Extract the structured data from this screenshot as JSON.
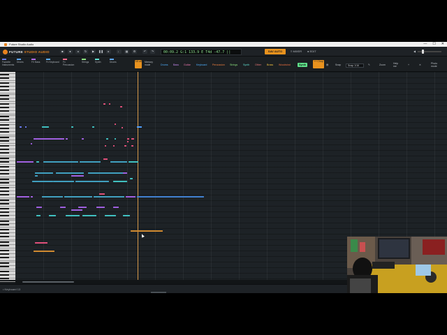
{
  "window": {
    "title": "Future Studio Audio",
    "controls": [
      "—",
      "☐",
      "✕"
    ]
  },
  "app": {
    "brand": "FUTURE",
    "brand_accent": "STUDIO AUDIO"
  },
  "transport": {
    "display": "00:09.2  G:1  133.9  E T4d  -47.7   ||"
  },
  "top_right": {
    "save_label": "SAV AUTO",
    "mixer_label": "≡ MIXER",
    "edit_label": "● EDIT"
  },
  "categories": [
    {
      "label": "Favorite Instruments",
      "color": "#6b7cf0"
    },
    {
      "label": "Drums",
      "color": "#5fa8ff"
    },
    {
      "label": "FX Bass",
      "color": "#b36cf0"
    },
    {
      "label": "Fx Keyboard",
      "color": "#5fb0ff"
    },
    {
      "label": "Fx Percussion",
      "color": "#ff6b8a"
    },
    {
      "label": "Strings",
      "color": "#8adf7e"
    },
    {
      "label": "Synth",
      "color": "#60e0d0"
    },
    {
      "label": "Drums",
      "color": "#5fa8ff"
    }
  ],
  "filter_pills": [
    {
      "label": "Drums",
      "color": "#4fb0ff"
    },
    {
      "label": "Bass",
      "color": "#c98af0"
    },
    {
      "label": "Guitar",
      "color": "#f07ab0"
    },
    {
      "label": "Keyboard",
      "color": "#4fb0ff"
    },
    {
      "label": "Percussion",
      "color": "#f08040"
    },
    {
      "label": "Strings",
      "color": "#8adf7e"
    },
    {
      "label": "Synth",
      "color": "#60e0d0"
    },
    {
      "label": "Other",
      "color": "#f07a7a"
    },
    {
      "label": "Brass",
      "color": "#f0c040"
    },
    {
      "label": "Woodwind",
      "color": "#f07040"
    }
  ],
  "synth_pill": "Synth",
  "selected_pattern": "1/8 all",
  "memory_label": "Memory mode",
  "chop_label": "++ Chop",
  "snap": {
    "label": "Snap",
    "value": "Snap 1/16"
  },
  "right_tools": [
    "Zoom",
    "Help me",
    "Photo mode"
  ],
  "status": {
    "text": "• Keyboard  13"
  },
  "accent_color": "#e8921e",
  "timeline": {
    "playhead_fraction": 0.283
  }
}
